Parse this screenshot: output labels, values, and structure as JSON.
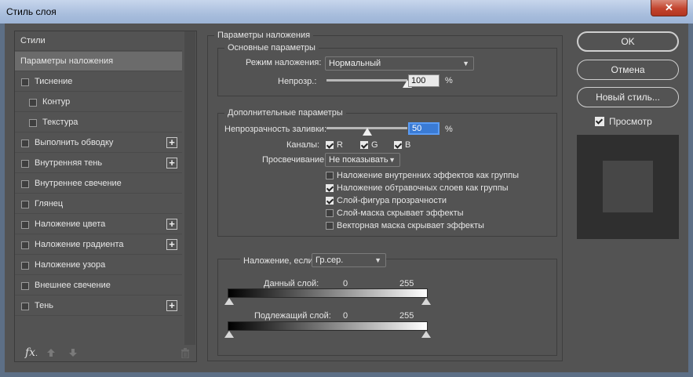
{
  "window": {
    "title": "Стиль слоя",
    "close_glyph": "✕"
  },
  "sidebar": {
    "items": [
      {
        "label": "Стили",
        "checkbox": false,
        "checked": false,
        "plus": false,
        "selected": false,
        "indent": 0
      },
      {
        "label": "Параметры наложения",
        "checkbox": false,
        "checked": false,
        "plus": false,
        "selected": true,
        "indent": 0
      },
      {
        "label": "Тиснение",
        "checkbox": true,
        "checked": false,
        "plus": false,
        "selected": false,
        "indent": 0
      },
      {
        "label": "Контур",
        "checkbox": true,
        "checked": false,
        "plus": false,
        "selected": false,
        "indent": 1
      },
      {
        "label": "Текстура",
        "checkbox": true,
        "checked": false,
        "plus": false,
        "selected": false,
        "indent": 1
      },
      {
        "label": "Выполнить обводку",
        "checkbox": true,
        "checked": false,
        "plus": true,
        "selected": false,
        "indent": 0
      },
      {
        "label": "Внутренняя тень",
        "checkbox": true,
        "checked": false,
        "plus": true,
        "selected": false,
        "indent": 0
      },
      {
        "label": "Внутреннее свечение",
        "checkbox": true,
        "checked": false,
        "plus": false,
        "selected": false,
        "indent": 0
      },
      {
        "label": "Глянец",
        "checkbox": true,
        "checked": false,
        "plus": false,
        "selected": false,
        "indent": 0
      },
      {
        "label": "Наложение цвета",
        "checkbox": true,
        "checked": false,
        "plus": true,
        "selected": false,
        "indent": 0
      },
      {
        "label": "Наложение градиента",
        "checkbox": true,
        "checked": false,
        "plus": true,
        "selected": false,
        "indent": 0
      },
      {
        "label": "Наложение узора",
        "checkbox": true,
        "checked": false,
        "plus": false,
        "selected": false,
        "indent": 0
      },
      {
        "label": "Внешнее свечение",
        "checkbox": true,
        "checked": false,
        "plus": false,
        "selected": false,
        "indent": 0
      },
      {
        "label": "Тень",
        "checkbox": true,
        "checked": false,
        "plus": true,
        "selected": false,
        "indent": 0
      }
    ],
    "footer": {
      "fx_label": "fx",
      "fx_dot": "."
    },
    "plus_glyph": "+"
  },
  "blending": {
    "title": "Параметры наложения",
    "general": {
      "title": "Основные параметры",
      "mode_label": "Режим наложения:",
      "mode_value": "Нормальный",
      "opacity_label": "Непрозр.:",
      "opacity_value": "100",
      "opacity_unit": "%",
      "opacity_fraction": 1.0
    },
    "advanced": {
      "title": "Дополнительные параметры",
      "fill_label": "Непрозрачность заливки:",
      "fill_value": "50",
      "fill_unit": "%",
      "fill_fraction": 0.5,
      "channels_label": "Каналы:",
      "channels": [
        {
          "label": "R",
          "checked": true
        },
        {
          "label": "G",
          "checked": true
        },
        {
          "label": "B",
          "checked": true
        }
      ],
      "knockout_label": "Просвечивание:",
      "knockout_value": "Не показывать",
      "options": [
        {
          "label": "Наложение внутренних эффектов как группы",
          "checked": false
        },
        {
          "label": "Наложение обтравочных слоев как группы",
          "checked": true
        },
        {
          "label": "Слой-фигура прозрачности",
          "checked": true
        },
        {
          "label": "Слой-маска скрывает эффекты",
          "checked": false
        },
        {
          "label": "Векторная маска скрывает эффекты",
          "checked": false
        }
      ]
    },
    "blend_if": {
      "label": "Наложение, если:",
      "value": "Гр.сер.",
      "this_layer_label": "Данный слой:",
      "this_layer_min": "0",
      "this_layer_max": "255",
      "underlying_label": "Подлежащий слой:",
      "underlying_min": "0",
      "underlying_max": "255"
    }
  },
  "buttons": {
    "ok": "OK",
    "cancel": "Отмена",
    "new_style": "Новый стиль...",
    "preview_label": "Просмотр",
    "preview_checked": true
  },
  "colors": {
    "background": "#535353",
    "selected_item": "#6b6b6b",
    "fill_highlight": "#3a7bd5",
    "titlebar": "#a9bedd"
  }
}
